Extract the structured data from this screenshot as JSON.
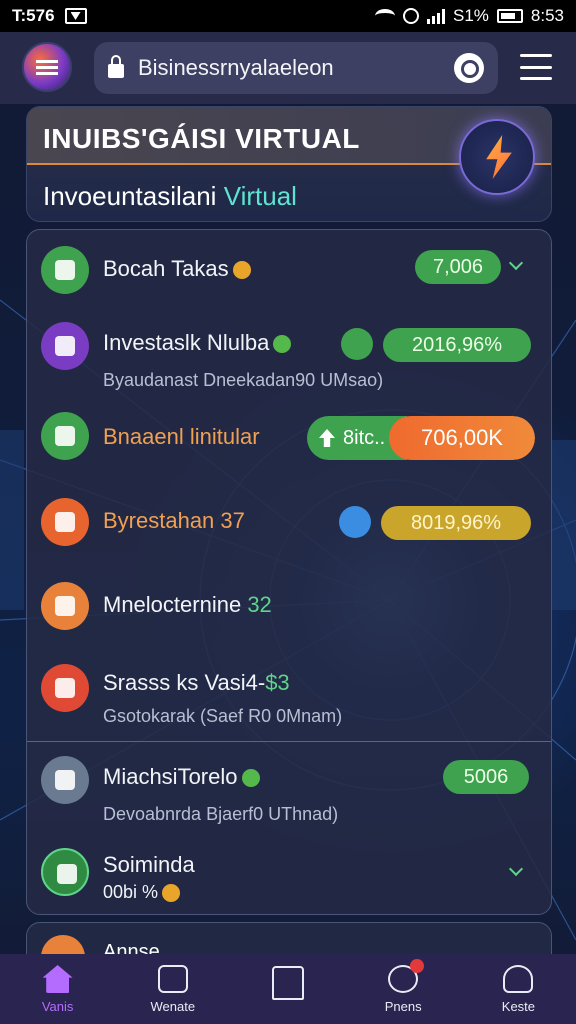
{
  "status_bar": {
    "time": "T:576",
    "battery": "S1%",
    "clock": "8:53"
  },
  "top_bar": {
    "search_text": "Bisinessrnyalaeleon"
  },
  "header": {
    "title": "INUIBS'GÁISI VIRTUAL",
    "subtitle_main": "Invoeuntasilani",
    "subtitle_accent": "Virtual"
  },
  "rows": [
    {
      "title": "Bocah Takas",
      "pill": "7,006"
    },
    {
      "title": "Investaslk Nlulba",
      "pill": "2016,96%",
      "sub": "Byaudanast Dneekadan90 UMsao)"
    },
    {
      "title": "Bnaaenl linitular",
      "pill_left": "8itc..",
      "pill_right": "706,00K"
    },
    {
      "title": "Byrestahan 37",
      "pill": "8019,96%"
    },
    {
      "title": "Mnelocternine",
      "value": "32"
    },
    {
      "title": "Srasss ks Vasi4-",
      "value": "$3",
      "sub": "Gsotokarak (Saef R0 0Mnam)"
    },
    {
      "title": "MiachsiTorelo",
      "pill": "5006",
      "sub": "Devoabnrda Bjaerf0 UThnad)"
    },
    {
      "title": "Soiminda",
      "sub": "00bi %"
    }
  ],
  "peek_card": {
    "title": "Annse"
  },
  "bottom_nav": [
    {
      "label": "Vanis"
    },
    {
      "label": "Wenate"
    },
    {
      "label": ""
    },
    {
      "label": "Pnens"
    },
    {
      "label": "Keste"
    }
  ],
  "colors": {
    "accent": "#5fe3d0",
    "green": "#3fa24e",
    "orange": "#ef6a2e",
    "nav_active": "#b46cff"
  }
}
